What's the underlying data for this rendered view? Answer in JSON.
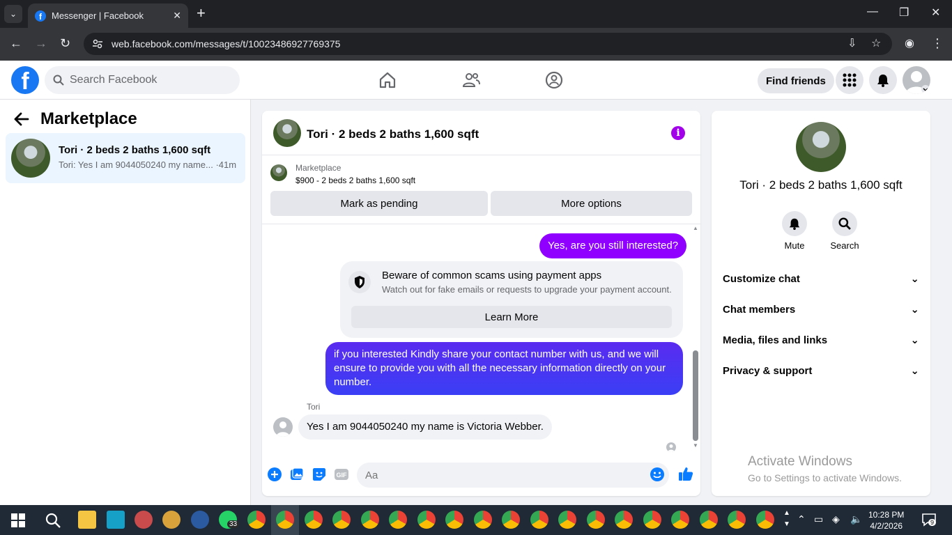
{
  "browser": {
    "tab_title": "Messenger | Facebook",
    "url": "web.facebook.com/messages/t/10023486927769375"
  },
  "header": {
    "search_placeholder": "Search Facebook",
    "find_friends": "Find friends"
  },
  "left_panel": {
    "title": "Marketplace",
    "conversation": {
      "name": "Tori · 2 beds 2 baths 1,600 sqft",
      "snippet": "Tori: Yes I am 9044050240 my name... ·41m"
    }
  },
  "chat": {
    "title": "Tori · 2 beds 2 baths 1,600 sqft",
    "marketplace_label": "Marketplace",
    "listing": "$900 - 2 beds 2 baths 1,600 sqft",
    "mark_pending": "Mark as pending",
    "more_options": "More options",
    "messages": {
      "out1": "Yes, are you still interested?",
      "warning_title": "Beware of common scams using payment apps",
      "warning_sub": "Watch out for fake emails or requests to upgrade your payment account.",
      "learn_more": "Learn More",
      "out2": "if you interested Kindly share your contact number with us, and we will ensure to provide you with all the necessary information directly on your number.",
      "sender": "Tori",
      "in1": "Yes I am 9044050240 my name is Victoria Webber."
    },
    "composer_placeholder": "Aa"
  },
  "right_panel": {
    "name": "Tori · 2 beds 2 baths 1,600 sqft",
    "mute": "Mute",
    "search": "Search",
    "sections": [
      "Customize chat",
      "Chat members",
      "Media, files and links",
      "Privacy & support"
    ]
  },
  "watermark": {
    "line1": "Activate Windows",
    "line2": "Go to Settings to activate Windows."
  },
  "taskbar": {
    "whatsapp_badge": "33",
    "time": "10:28 PM",
    "date": "4/2/2026",
    "notif_count": "9"
  },
  "colors": {
    "brand": "#1877f2",
    "accent_purple": "#a100e8",
    "bubble_gradient_start": "#8f00ff",
    "bubble_gradient_end": "#3a3ff5"
  }
}
